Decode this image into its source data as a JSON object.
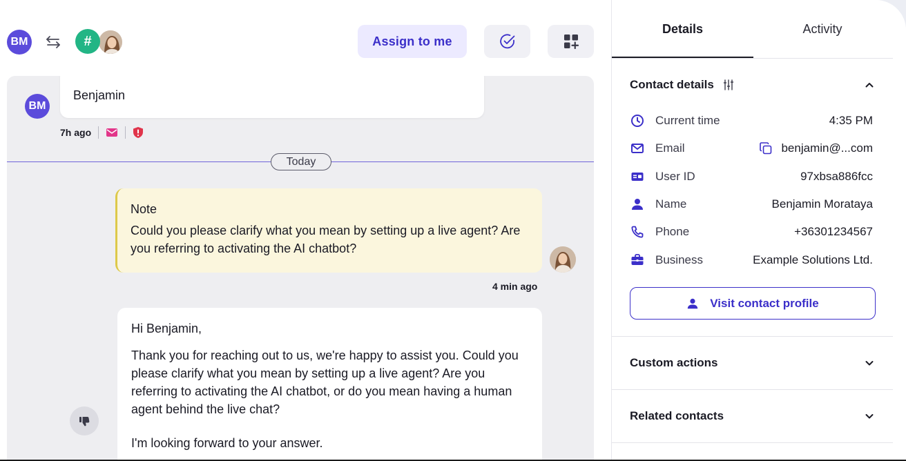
{
  "header": {
    "user_initials": "BM",
    "channel_badge": "#",
    "assign_label": "Assign to me"
  },
  "conversation": {
    "incoming": {
      "sender_initials": "BM",
      "text": "Benjamin",
      "time": "7h ago"
    },
    "divider_label": "Today",
    "note": {
      "title": "Note",
      "body": "Could you please clarify what you mean by setting up a live agent? Are you referring to activating the AI chatbot?",
      "time": "4 min ago"
    },
    "reply": {
      "greeting": "Hi Benjamin,",
      "body": "Thank you for reaching out to us, we're happy to assist you. Could you please clarify what you mean by setting up a live agent? Are you referring to activating the AI chatbot, or do you mean having a human agent behind the live chat?",
      "closing": "I'm looking forward to your answer."
    }
  },
  "panel": {
    "tabs": [
      {
        "label": "Details",
        "active": true
      },
      {
        "label": "Activity",
        "active": false
      }
    ],
    "contact_details": {
      "title": "Contact details",
      "rows": [
        {
          "icon": "clock-icon",
          "label": "Current time",
          "value": "4:35 PM"
        },
        {
          "icon": "mail-icon",
          "label": "Email",
          "value": "benjamin@...com"
        },
        {
          "icon": "id-card-icon",
          "label": "User ID",
          "value": "97xbsa886fcc"
        },
        {
          "icon": "person-icon",
          "label": "Name",
          "value": "Benjamin Morataya"
        },
        {
          "icon": "phone-icon",
          "label": "Phone",
          "value": "+36301234567"
        },
        {
          "icon": "briefcase-icon",
          "label": "Business",
          "value": "Example Solutions Ltd."
        }
      ],
      "visit_label": "Visit contact profile"
    },
    "custom_actions": {
      "title": "Custom actions"
    },
    "related_contacts": {
      "title": "Related contacts"
    }
  },
  "colors": {
    "accent": "#3b2fc9",
    "avatar_purple": "#5b4bdb",
    "channel_green": "#22b585",
    "note_background": "#fbf6dd",
    "note_border": "#ddc94a",
    "email_channel": "#e2368a",
    "alert_red": "#e0344b"
  }
}
